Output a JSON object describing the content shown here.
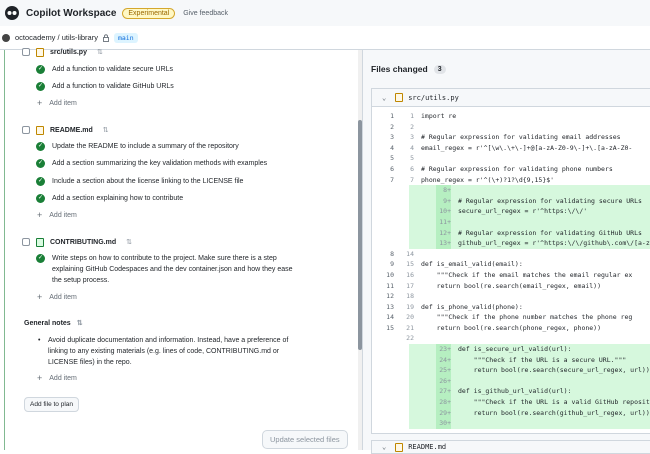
{
  "header": {
    "title": "Copilot Workspace",
    "badge": "Experimental",
    "feedback": "Give feedback"
  },
  "repo": {
    "path": "octocademy / utils-library",
    "branch": "main"
  },
  "plan": {
    "file_utils": "src/utils.py",
    "utils_tasks": [
      "Add a function to validate secure URLs",
      "Add a function to validate GitHub URLs"
    ],
    "add_item": "Add item",
    "file_readme": "README.md",
    "readme_tasks": [
      "Update the README to include a summary of the repository",
      "Add a section summarizing the key validation methods with examples",
      "Include a section about the license linking to the LICENSE file",
      "Add a section explaining how to contribute"
    ],
    "file_contrib": "CONTRIBUTING.md",
    "contrib_task_line1": "Write steps on how to contribute to the project. Make sure there is a step",
    "contrib_task_line2": "explaining GitHub Codespaces and the dev container.json and how they ease",
    "contrib_task_line3": "the setup process.",
    "notes_title": "General notes",
    "note_line1": "Avoid duplicate documentation and information. Instead, have a preference of",
    "note_line2": "linking to any existing materials (e.g. lines of code, CONTRIBUTING.md or",
    "note_line3": "LICENSE files) in the repo.",
    "add_file": "Add file to plan",
    "update_button": "Update selected files"
  },
  "diff": {
    "files_changed_label": "Files changed",
    "files_changed_count": "3",
    "file_path": "src/utils.py",
    "second_file": "README.md",
    "lines": [
      {
        "old": "1",
        "new": "1",
        "code": "import re",
        "add": false
      },
      {
        "old": "2",
        "new": "2",
        "code": "",
        "add": false
      },
      {
        "old": "3",
        "new": "3",
        "code": "# Regular expression for validating email addresses",
        "add": false
      },
      {
        "old": "4",
        "new": "4",
        "code": "email_regex = r'^[\\w\\.\\+\\-]+@[a-zA-Z0-9\\-]+\\.[a-zA-Z0-",
        "add": false
      },
      {
        "old": "5",
        "new": "5",
        "code": "",
        "add": false
      },
      {
        "old": "6",
        "new": "6",
        "code": "# Regular expression for validating phone numbers",
        "add": false
      },
      {
        "old": "7",
        "new": "7",
        "code": "phone_regex = r'^(\\+)?1?\\d{9,15}$'",
        "add": false
      },
      {
        "old": "",
        "new": "8+",
        "code": "",
        "add": true
      },
      {
        "old": "",
        "new": "9+",
        "code": "# Regular expression for validating secure URLs",
        "add": true
      },
      {
        "old": "",
        "new": "10+",
        "code": "secure_url_regex = r'^https:\\/\\/'",
        "add": true
      },
      {
        "old": "",
        "new": "11+",
        "code": "",
        "add": true
      },
      {
        "old": "",
        "new": "12+",
        "code": "# Regular expression for validating GitHub URLs",
        "add": true
      },
      {
        "old": "",
        "new": "13+",
        "code": "github_url_regex = r'^https:\\/\\/github\\.com\\/[a-zA-Z0-",
        "add": true
      },
      {
        "old": "8",
        "new": "14",
        "code": "",
        "add": false
      },
      {
        "old": "9",
        "new": "15",
        "code": "def is_email_valid(email):",
        "add": false
      },
      {
        "old": "10",
        "new": "16",
        "code": "    \"\"\"Check if the email matches the email regular ex",
        "add": false
      },
      {
        "old": "11",
        "new": "17",
        "code": "    return bool(re.search(email_regex, email))",
        "add": false
      },
      {
        "old": "12",
        "new": "18",
        "code": "",
        "add": false
      },
      {
        "old": "13",
        "new": "19",
        "code": "def is_phone_valid(phone):",
        "add": false
      },
      {
        "old": "14",
        "new": "20",
        "code": "    \"\"\"Check if the phone number matches the phone reg",
        "add": false
      },
      {
        "old": "15",
        "new": "21",
        "code": "    return bool(re.search(phone_regex, phone))",
        "add": false
      },
      {
        "old": "",
        "new": "22",
        "code": "",
        "add": false
      },
      {
        "old": "",
        "new": "23+",
        "code": "def is_secure_url_valid(url):",
        "add": true
      },
      {
        "old": "",
        "new": "24+",
        "code": "    \"\"\"Check if the URL is a secure URL.\"\"\"",
        "add": true
      },
      {
        "old": "",
        "new": "25+",
        "code": "    return bool(re.search(secure_url_regex, url))",
        "add": true
      },
      {
        "old": "",
        "new": "26+",
        "code": "",
        "add": true
      },
      {
        "old": "",
        "new": "27+",
        "code": "def is_github_url_valid(url):",
        "add": true
      },
      {
        "old": "",
        "new": "28+",
        "code": "    \"\"\"Check if the URL is a valid GitHub repository u",
        "add": true
      },
      {
        "old": "",
        "new": "29+",
        "code": "    return bool(re.search(github_url_regex, url))",
        "add": true
      },
      {
        "old": "",
        "new": "30+",
        "code": "",
        "add": true
      }
    ]
  }
}
